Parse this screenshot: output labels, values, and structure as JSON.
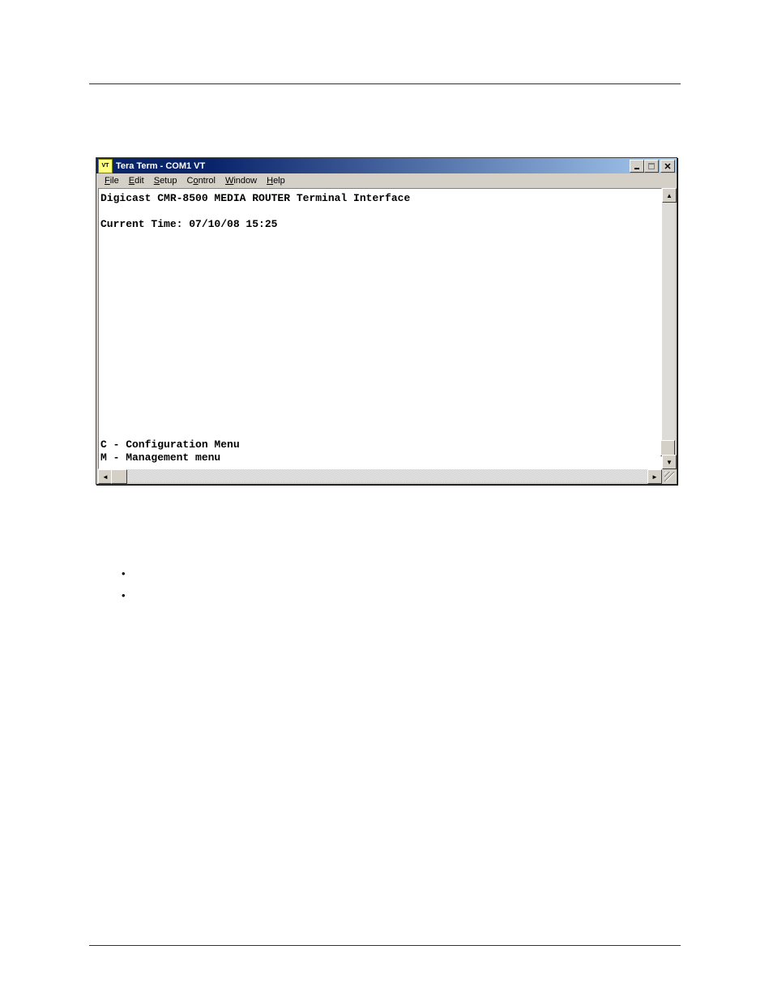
{
  "window": {
    "title": "Tera Term - COM1 VT",
    "icon_label": "VT"
  },
  "menubar": {
    "file": "File",
    "edit": "Edit",
    "setup": "Setup",
    "control": "Control",
    "window": "Window",
    "help": "Help"
  },
  "terminal": {
    "line1": "Digicast CMR-8500 MEDIA ROUTER Terminal Interface",
    "line2": "Current Time: 07/10/08 15:25",
    "menu_c": "C - Configuration Menu",
    "menu_m": "M - Management menu"
  }
}
